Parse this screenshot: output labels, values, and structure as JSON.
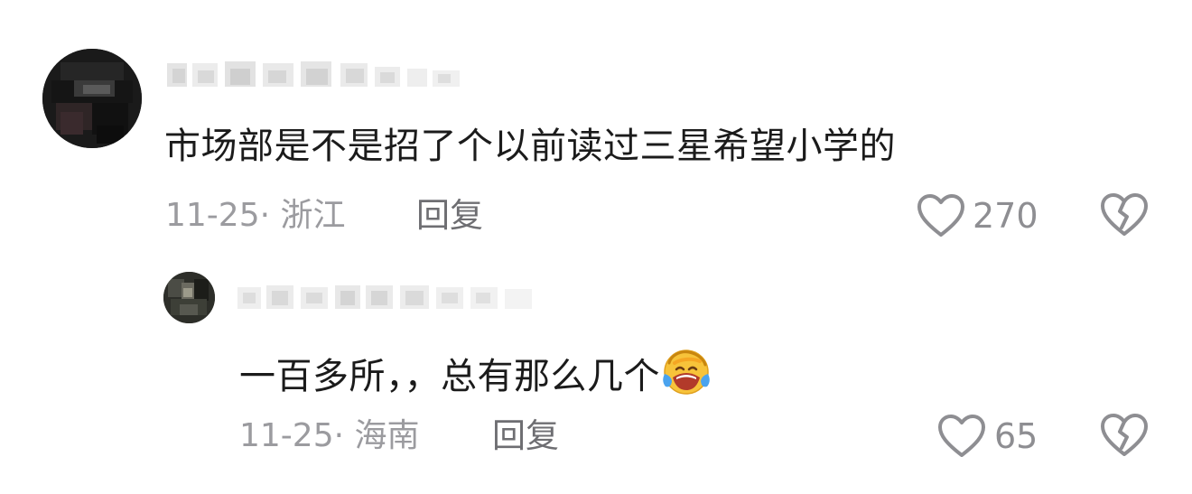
{
  "comments": [
    {
      "content": "市场部是不是招了个以前读过三星希望小学的",
      "date_location": "11-25· 浙江",
      "reply_label": "回复",
      "likes": "270",
      "like_icon": "heart-outline-icon",
      "dislike_icon": "broken-heart-icon"
    }
  ],
  "replies": [
    {
      "content": "一百多所，，总有那么几个",
      "emoji": "crying-laughing-emoji",
      "date_location": "11-25· 海南",
      "reply_label": "回复",
      "likes": "65",
      "like_icon": "heart-outline-icon",
      "dislike_icon": "broken-heart-icon"
    }
  ],
  "colors": {
    "text_primary": "#1b1b1b",
    "text_meta": "#9b9b9f",
    "icon_gray": "#8e8e92",
    "background": "#ffffff"
  }
}
